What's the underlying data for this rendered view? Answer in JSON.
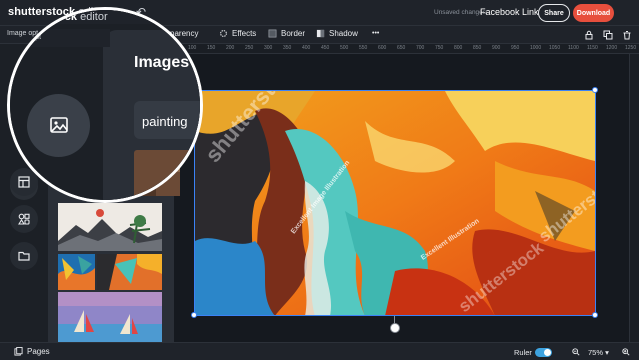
{
  "header": {
    "brand": "shutterstock",
    "brand_suffix": "editor",
    "unsaved": "Unsaved changes",
    "doc_title": "Facebook Link",
    "share_label": "Share",
    "download_label": "Download"
  },
  "toolbar": {
    "image_options": "Image opt",
    "transparency": "parency",
    "effects": "Effects",
    "border": "Border",
    "shadow": "Shadow",
    "more": "•••"
  },
  "ruler": {
    "marks": [
      "100",
      "150",
      "200",
      "250",
      "300",
      "350",
      "400",
      "450",
      "500",
      "550",
      "600",
      "650",
      "700",
      "750",
      "800",
      "850",
      "900",
      "950",
      "1000",
      "1050",
      "1100",
      "1150",
      "1200",
      "1250"
    ]
  },
  "panel": {
    "title": "Images",
    "search_value": "painting"
  },
  "artwork": {
    "watermarks": [
      "shutterstock",
      "Excellent Image Illustration",
      "Excellent Illustration",
      "shutterstock",
      "shutterstock",
      "shutterstock"
    ]
  },
  "footer": {
    "pages_label": "Pages",
    "ruler_label": "Ruler",
    "zoom_value": "75%"
  },
  "colors": {
    "accent": "#e74f3d",
    "selection": "#3b82f6",
    "toggle": "#3da3e0"
  }
}
